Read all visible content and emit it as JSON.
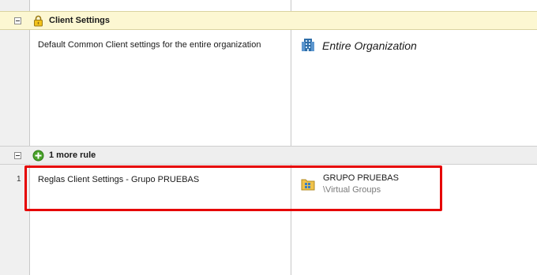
{
  "groups": [
    {
      "label": "Client Settings",
      "icon": "lock-icon",
      "rows": [
        {
          "name": "Default Common Client settings for the entire organization",
          "target": "Entire Organization",
          "target_icon": "organization-building-icon"
        }
      ]
    },
    {
      "label": "1 more rule",
      "icon": "add-circle-icon",
      "rows": [
        {
          "number": "1",
          "name": "Reglas Client Settings - Grupo PRUEBAS",
          "target": "GRUPO PRUEBAS",
          "target_path": "\\Virtual Groups",
          "target_icon": "virtual-group-folder-icon"
        }
      ]
    }
  ],
  "colors": {
    "client_settings_bar": "#fcf7d2",
    "more_rules_bar": "#eeeeee",
    "highlight_border": "#e60000",
    "add_icon": "#4aa32a"
  }
}
